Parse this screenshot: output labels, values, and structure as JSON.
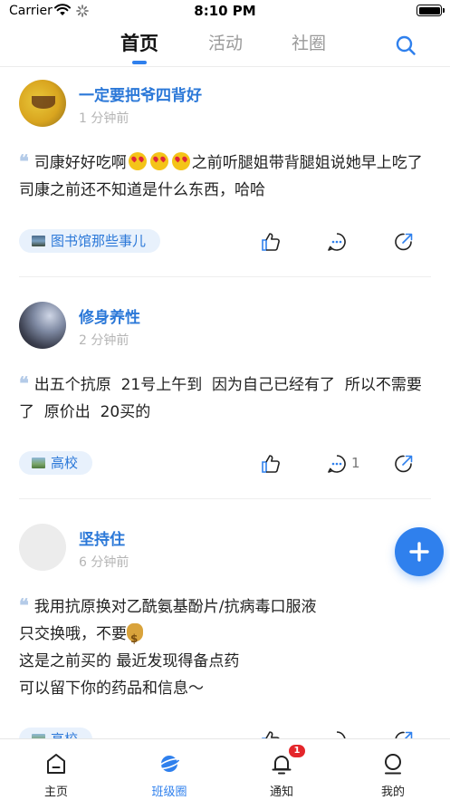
{
  "status_bar": {
    "carrier": "Carrier",
    "time": "8:10 PM"
  },
  "top_nav": {
    "tabs": [
      {
        "label": "首页",
        "active": true
      },
      {
        "label": "活动",
        "active": false
      },
      {
        "label": "社圈",
        "active": false
      }
    ],
    "search_icon": "search-icon"
  },
  "posts": [
    {
      "username": "一定要把爷四背好",
      "time": "1 分钟前",
      "text_before_emoji": "司康好好吃啊",
      "text_after_emoji": "之前听腿姐带背腿姐说她早上吃了司康之前还不知道是什么东西，哈哈",
      "emoji": "heart-eyes-emoji",
      "tag": "图书馆那些事儿",
      "comment_count": ""
    },
    {
      "username": "修身养性",
      "time": "2 分钟前",
      "text": "出五个抗原  21号上午到  因为自己已经有了  所以不需要了  原价出  20买的",
      "tag": "高校",
      "comment_count": "1"
    },
    {
      "username": "坚持住",
      "time": "6 分钟前",
      "lines": [
        "我用抗原换对乙酰氨基酚片/抗病毒口服液",
        "只交换哦，不要",
        "这是之前买的 最近发现得备点药",
        "可以留下你的药品和信息～"
      ],
      "emoji": "money-bag-emoji",
      "tag": "高校",
      "comment_count": ""
    }
  ],
  "bottom_bar": {
    "items": [
      {
        "label": "主页",
        "icon": "home-icon",
        "active": false
      },
      {
        "label": "班级圈",
        "icon": "planet-icon",
        "active": true
      },
      {
        "label": "通知",
        "icon": "bell-icon",
        "active": false,
        "badge": "1"
      },
      {
        "label": "我的",
        "icon": "profile-icon",
        "active": false
      }
    ]
  },
  "colors": {
    "accent": "#2f80ed",
    "username": "#2b78d8",
    "badge": "#e4262b"
  }
}
